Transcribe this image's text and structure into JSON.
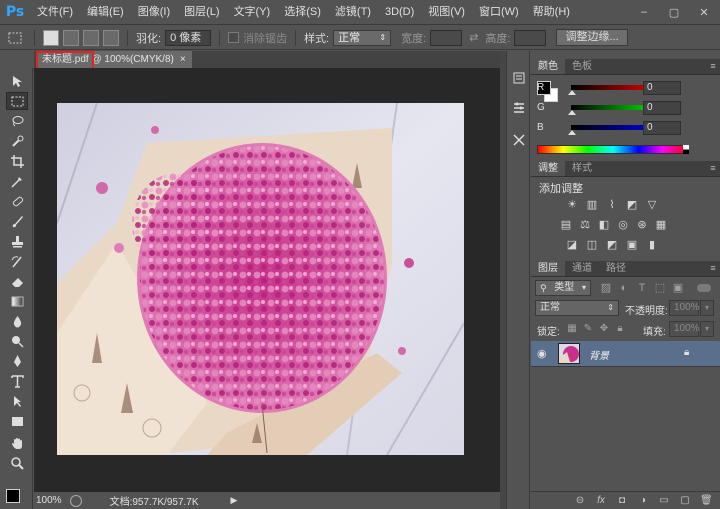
{
  "app": {
    "logo": "Ps"
  },
  "menu": [
    "文件(F)",
    "编辑(E)",
    "图像(I)",
    "图层(L)",
    "文字(Y)",
    "选择(S)",
    "滤镜(T)",
    "3D(D)",
    "视图(V)",
    "窗口(W)",
    "帮助(H)"
  ],
  "window_controls": {
    "minimize": "–",
    "restore": "▢",
    "close": "✕"
  },
  "options": {
    "feather_label": "羽化:",
    "feather_value": "0 像素",
    "antialias_label": "消除锯齿",
    "style_label": "样式:",
    "style_value": "正常",
    "width_label": "宽度:",
    "height_label": "高度:",
    "refine_edge_button": "调整边缘..."
  },
  "document": {
    "tab_title": "未标题.pdf @ 100%(CMYK/8)",
    "tab_close": "×",
    "zoom": "100%",
    "doc_info": "文档:957.7K/957.7K"
  },
  "color_panel": {
    "tabs": [
      "颜色",
      "色板"
    ],
    "channels": [
      {
        "label": "R",
        "value": "0",
        "color": "#e02020"
      },
      {
        "label": "G",
        "value": "0",
        "color": "#20c020"
      },
      {
        "label": "B",
        "value": "0",
        "color": "#2040e0"
      }
    ]
  },
  "adjust_panel": {
    "tabs": [
      "调整",
      "样式"
    ],
    "heading": "添加调整",
    "icon_rows": [
      [
        "brightness-icon",
        "levels-icon",
        "curves-icon",
        "exposure-icon",
        "vibrance-icon"
      ],
      [
        "hue-saturation-icon",
        "color-balance-icon",
        "black-white-icon",
        "photo-filter-icon",
        "channel-mixer-icon",
        "color-lookup-icon"
      ],
      [
        "invert-icon",
        "posterize-icon",
        "threshold-icon",
        "selective-color-icon",
        "gradient-map-icon"
      ]
    ]
  },
  "layers_panel": {
    "tabs": [
      "图层",
      "通道",
      "路径"
    ],
    "filter_kind": "类型",
    "blend_mode": "正常",
    "opacity_label": "不透明度:",
    "opacity_value": "100%",
    "lock_label": "锁定:",
    "fill_label": "填充:",
    "fill_value": "100%",
    "layers": [
      {
        "name": "背景",
        "visible": true,
        "locked": true
      }
    ]
  },
  "colors": {
    "accent_selected_layer": "#5a6f8c",
    "highlight_box": "#e52222",
    "logo": "#31a8ff"
  }
}
